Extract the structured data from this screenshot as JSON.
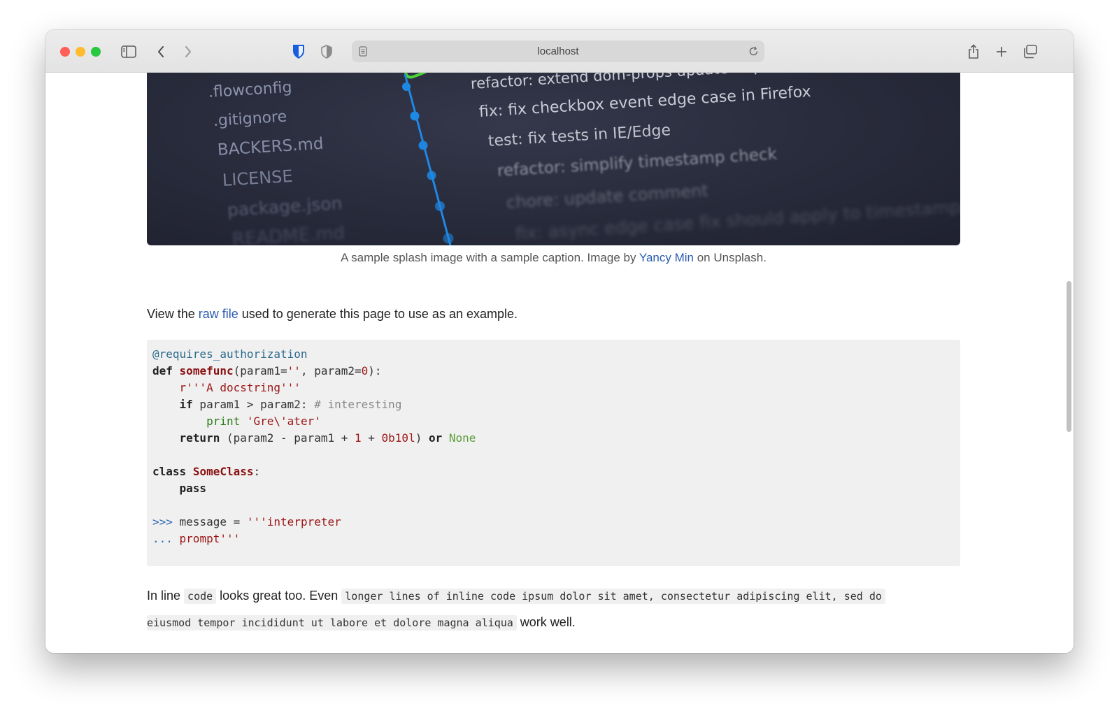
{
  "browser": {
    "url": "localhost",
    "traffic_colors": {
      "close": "#ff5f57",
      "minimize": "#febc2e",
      "zoom": "#28c840"
    },
    "icons": [
      "sidebar-icon",
      "back-icon",
      "forward-icon",
      "bitwarden-icon",
      "privacy-shield-icon",
      "reader-icon",
      "reload-icon",
      "share-icon",
      "new-tab-icon",
      "tab-overview-icon"
    ]
  },
  "hero": {
    "files": [
      ".flowconfig",
      ".gitignore",
      "BACKERS.md",
      "LICENSE",
      "package.json",
      "README.md"
    ],
    "commits": [
      "refactor: extend dom-props update skip",
      "fix: fix checkbox event edge case in Firefox",
      "test: fix tests in IE/Edge",
      "refactor: simplify timestamp check",
      "chore: update comment",
      "fix: async edge case fix should apply to timestamp/attach"
    ],
    "graph_color": "#1e88e5",
    "branch_color": "#4cd137"
  },
  "caption": {
    "before": "A sample splash image with a sample caption. Image by ",
    "link": "Yancy Min",
    "after": " on Unsplash."
  },
  "intro": {
    "before": "View the ",
    "link": "raw file",
    "after": " used to generate this page to use as an example."
  },
  "code": {
    "decorator": "@requires_authorization",
    "def_kw": "def",
    "func_name": "somefunc",
    "sig_a": "(param1=",
    "sig_str": "''",
    "sig_b": ", param2=",
    "sig_num": "0",
    "sig_c": "):",
    "docstring": "r'''A docstring'''",
    "if_kw": "if",
    "cond": " param1 > param2: ",
    "comment": "# interesting",
    "print_kw": "print",
    "print_str": "'Gre\\'ater'",
    "return_kw": "return",
    "ret_a": " (param2 - param1 + ",
    "ret_num1": "1",
    "ret_plus": " + ",
    "ret_num2": "0b10l",
    "ret_b": ") ",
    "or_kw": "or",
    "none_kw": "None",
    "class_kw": "class",
    "class_name": "SomeClass",
    "class_colon": ":",
    "pass_kw": "pass",
    "prompt1": ">>>",
    "msg": " message = ",
    "msg_str": "'''interpreter",
    "prompt2": "...",
    "prompt_str": " prompt'''"
  },
  "inline": {
    "t1": "In line ",
    "c1": "code",
    "t2": " looks great too. Even ",
    "c2a": "longer lines of inline code ipsum dolor sit amet, consectetur adipiscing elit, sed do",
    "c2b": "eiusmod tempor incididunt ut labore et dolore magna aliqua",
    "t3": " work well."
  }
}
